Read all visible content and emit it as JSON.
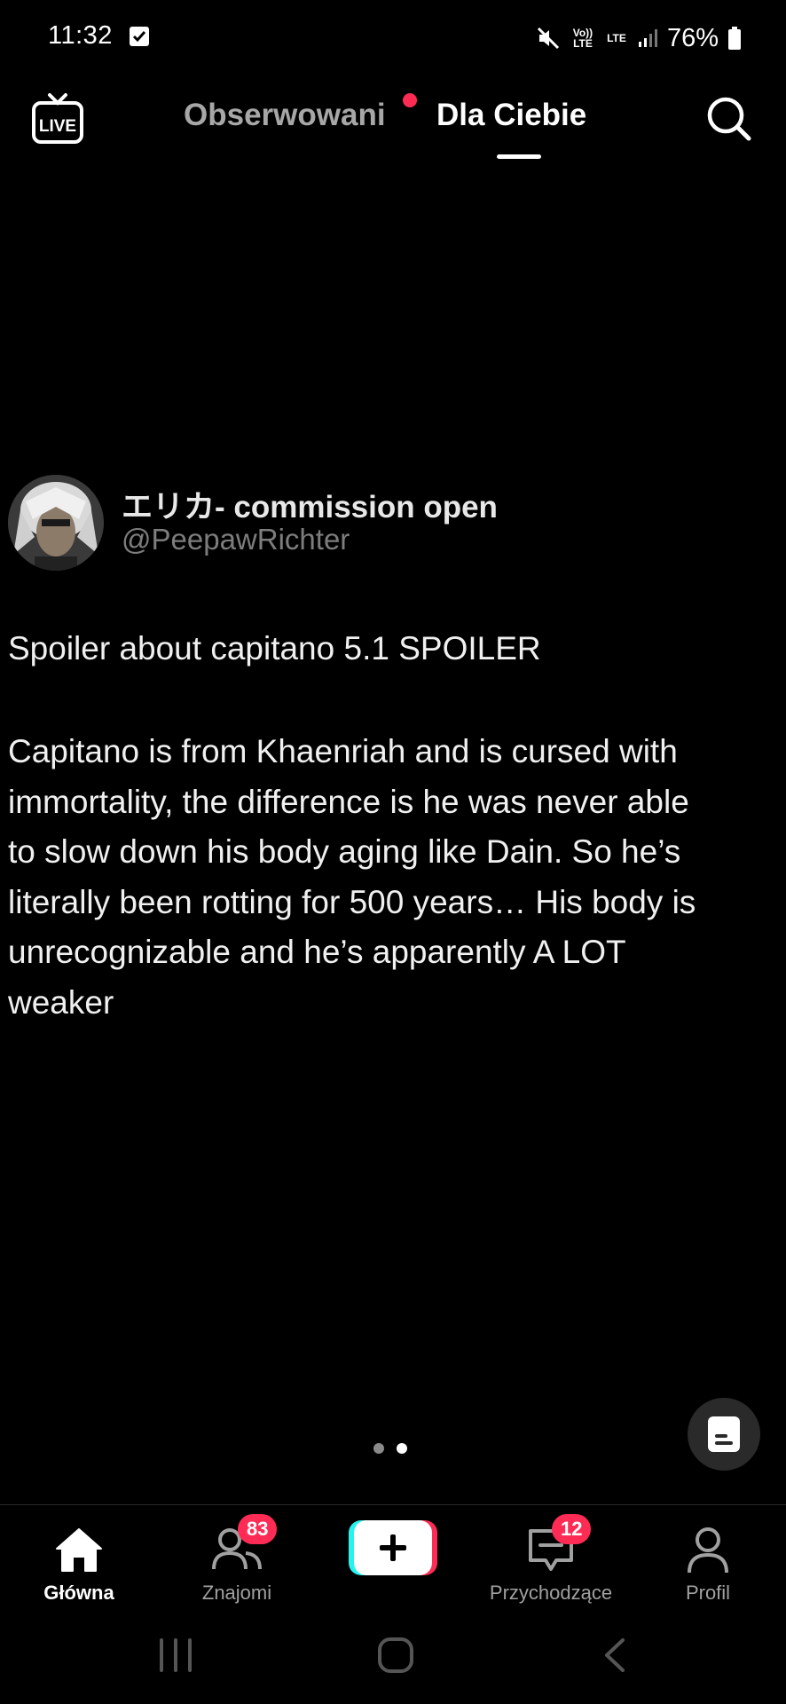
{
  "status_bar": {
    "time": "11:32",
    "network_volte": "Vo)) LTE",
    "network_lte": "LTE",
    "battery": "76%"
  },
  "top_nav": {
    "live_label": "LIVE",
    "tabs": [
      {
        "label": "Obserwowani",
        "active": false,
        "has_notification_dot": true
      },
      {
        "label": "Dla Ciebie",
        "active": true
      }
    ]
  },
  "post": {
    "display_name": "エリカ- commission open",
    "handle": "@PeepawRichter",
    "title": "Spoiler about capitano 5.1 SPOILER",
    "body_lines": [
      "Capitano is from Khaenriah and is cursed with",
      "immortality, the difference is he was never able",
      "to slow down his body aging like Dain. So he’s",
      "literally been rotting for 500 years… His body is",
      "unrecognizable and he’s apparently A LOT",
      "weaker"
    ]
  },
  "carousel": {
    "total_pages": 2,
    "current_page": 2
  },
  "bottom_nav": {
    "items": [
      {
        "label": "Główna",
        "active": true
      },
      {
        "label": "Znajomi",
        "badge": "83"
      },
      {
        "label": "",
        "type": "create"
      },
      {
        "label": "Przychodzące",
        "badge": "12"
      },
      {
        "label": "Profil"
      }
    ]
  },
  "colors": {
    "background": "#000000",
    "accent_red": "#fe2c55",
    "inactive_text": "#a7a7a7",
    "create_cyan": "#25f4ee"
  }
}
